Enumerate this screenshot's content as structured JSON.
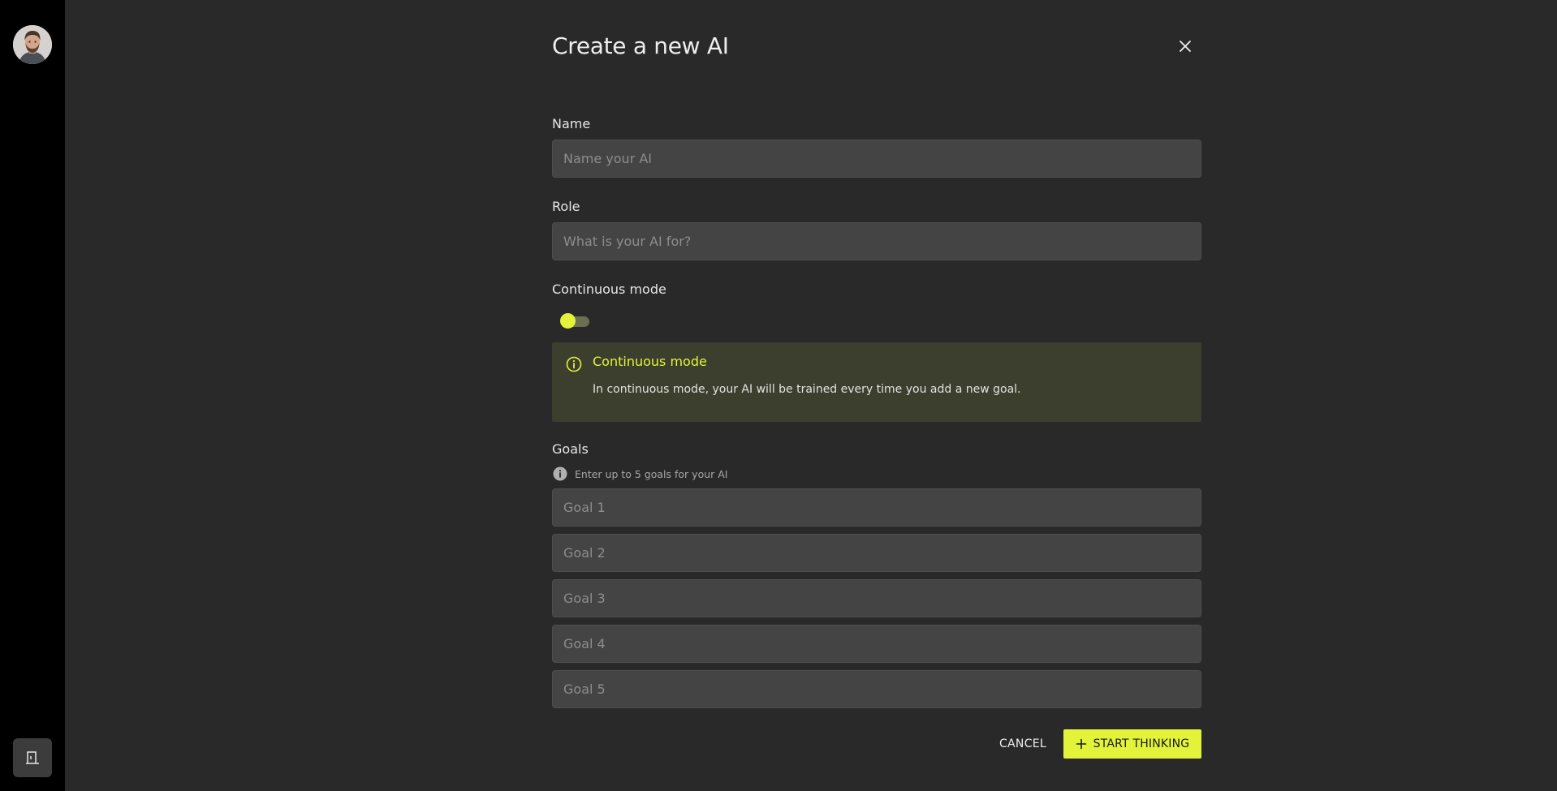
{
  "sidebar": {
    "avatar_icon": "user-avatar",
    "exit_icon": "exit-door-icon"
  },
  "dialog": {
    "title": "Create a new AI",
    "close_icon": "close-icon"
  },
  "form": {
    "name": {
      "label": "Name",
      "placeholder": "Name your AI",
      "value": ""
    },
    "role": {
      "label": "Role",
      "placeholder": "What is your AI for?",
      "value": ""
    },
    "continuous": {
      "label": "Continuous mode",
      "enabled": false
    },
    "info": {
      "icon": "info-icon",
      "title": "Continuous mode",
      "text": "In continuous mode, your AI will be trained every time you add a new goal."
    },
    "goals": {
      "label": "Goals",
      "hint": "Enter up to 5 goals for your AI",
      "items": [
        {
          "placeholder": "Goal 1",
          "value": ""
        },
        {
          "placeholder": "Goal 2",
          "value": ""
        },
        {
          "placeholder": "Goal 3",
          "value": ""
        },
        {
          "placeholder": "Goal 4",
          "value": ""
        },
        {
          "placeholder": "Goal 5",
          "value": ""
        }
      ]
    }
  },
  "actions": {
    "cancel_label": "CANCEL",
    "start_label": "START THINKING",
    "start_icon": "plus-icon"
  },
  "colors": {
    "accent": "#e3f33a",
    "background": "#282928",
    "sidebar": "#000000",
    "field": "#434443",
    "info_background": "#3c3f2d"
  }
}
